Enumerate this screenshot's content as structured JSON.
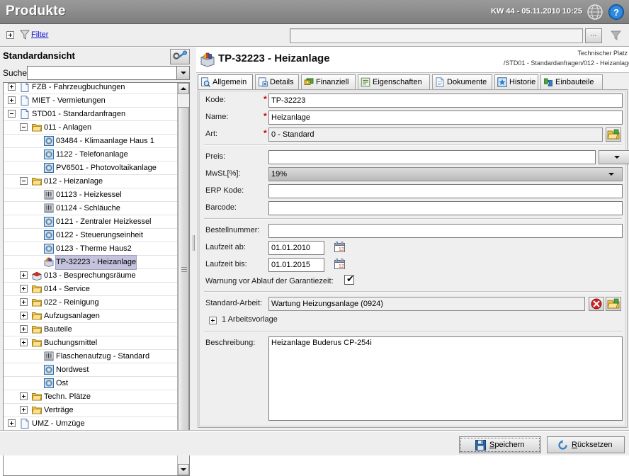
{
  "titlebar": {
    "app_title": "Produkte",
    "clock": "KW 44 - 05.11.2010 10:25",
    "globe_icon": "globe-icon",
    "help_icon": "help-question-icon"
  },
  "filterbar": {
    "expander": "plus-expander-icon",
    "funnel_icon": "funnel-icon",
    "label": "Filter",
    "input_value": "",
    "input_placeholder": "",
    "ellipsis_button": "...",
    "funnel_right_icon": "funnel-icon"
  },
  "sidebar": {
    "title": "Standardansicht",
    "tool_button": "configure-view-icon",
    "search_label": "Suche:",
    "search_value": "",
    "search_placeholder": "",
    "dropdown_icon": "chevron-down-icon",
    "scroll_up_icon": "scroll-up-arrow",
    "scroll_down_icon": "scroll-down-arrow",
    "tree": [
      {
        "label": "FZB - Fahrzeugbuchungen",
        "indent": 0,
        "expander": "plus",
        "icon": "document-blue-icon",
        "selected": false,
        "clipped": true
      },
      {
        "label": "MIET - Vermietungen",
        "indent": 0,
        "expander": "plus",
        "icon": "document-icon",
        "selected": false
      },
      {
        "label": "STD01 - Standardanfragen",
        "indent": 0,
        "expander": "minus",
        "icon": "document-icon",
        "selected": false
      },
      {
        "label": "011 - Anlagen",
        "indent": 1,
        "expander": "minus",
        "icon": "folder-icon",
        "selected": false
      },
      {
        "label": "03484 - Klimaanlage Haus 1",
        "indent": 2,
        "expander": "none",
        "icon": "globe-blue-icon",
        "selected": false
      },
      {
        "label": "1122 - Telefonanlage",
        "indent": 2,
        "expander": "none",
        "icon": "globe-blue-icon",
        "selected": false
      },
      {
        "label": "PV6501 - Photovoltaikanlage",
        "indent": 2,
        "expander": "none",
        "icon": "globe-blue-icon",
        "selected": false
      },
      {
        "label": "012 - Heizanlage",
        "indent": 1,
        "expander": "minus",
        "icon": "folder-icon",
        "selected": false
      },
      {
        "label": "01123 - Heizkessel",
        "indent": 2,
        "expander": "none",
        "icon": "barcode-icon",
        "selected": false
      },
      {
        "label": "01124 - Schläuche",
        "indent": 2,
        "expander": "none",
        "icon": "barcode-icon",
        "selected": false
      },
      {
        "label": "0121 - Zentraler Heizkessel",
        "indent": 2,
        "expander": "none",
        "icon": "globe-blue-icon",
        "selected": false
      },
      {
        "label": "0122 - Steuerungseinheit",
        "indent": 2,
        "expander": "none",
        "icon": "globe-blue-icon",
        "selected": false
      },
      {
        "label": "0123 - Therme Haus2",
        "indent": 2,
        "expander": "none",
        "icon": "globe-blue-icon",
        "selected": false
      },
      {
        "label": "TP-32223 - Heizanlage",
        "indent": 2,
        "expander": "none",
        "icon": "product-box-icon",
        "selected": true
      },
      {
        "label": "013 - Besprechungsräume",
        "indent": 1,
        "expander": "plus",
        "icon": "red-box-icon",
        "selected": false
      },
      {
        "label": "014 - Service",
        "indent": 1,
        "expander": "plus",
        "icon": "folder-icon",
        "selected": false
      },
      {
        "label": "022 - Reinigung",
        "indent": 1,
        "expander": "plus",
        "icon": "folder-icon",
        "selected": false
      },
      {
        "label": "Aufzugsanlagen",
        "indent": 1,
        "expander": "plus",
        "icon": "folder-icon",
        "selected": false
      },
      {
        "label": "Bauteile",
        "indent": 1,
        "expander": "plus",
        "icon": "folder-icon",
        "selected": false
      },
      {
        "label": "Buchungsmittel",
        "indent": 1,
        "expander": "plus",
        "icon": "folder-icon",
        "selected": false
      },
      {
        "label": "Flaschenaufzug - Standard",
        "indent": 2,
        "expander": "none",
        "icon": "barcode-icon",
        "selected": false
      },
      {
        "label": "Nordwest",
        "indent": 2,
        "expander": "none",
        "icon": "globe-blue-icon",
        "selected": false
      },
      {
        "label": "Ost",
        "indent": 2,
        "expander": "none",
        "icon": "globe-blue-icon",
        "selected": false
      },
      {
        "label": "Techn. Plätze",
        "indent": 1,
        "expander": "plus",
        "icon": "folder-icon",
        "selected": false
      },
      {
        "label": "Verträge",
        "indent": 1,
        "expander": "plus",
        "icon": "folder-icon",
        "selected": false
      },
      {
        "label": "UMZ - Umzüge",
        "indent": 0,
        "expander": "plus",
        "icon": "document-icon",
        "selected": false
      }
    ]
  },
  "detail": {
    "icon": "product-box-icon",
    "title": "TP-32223 - Heizanlage",
    "breadcrumb_line1": "Technischer Platz",
    "breadcrumb_line2": "/STD01 - Standardanfragen/012 - Heizanlage",
    "tabs": [
      {
        "label": "Allgemein",
        "icon": "magnifier-doc-icon",
        "active": true
      },
      {
        "label": "Details",
        "icon": "doc-plus-icon",
        "active": false
      },
      {
        "label": "Finanziell",
        "icon": "money-icon",
        "active": false
      },
      {
        "label": "Eigenschaften",
        "icon": "properties-icon",
        "active": false
      },
      {
        "label": "Dokumente",
        "icon": "document-icon",
        "active": false
      },
      {
        "label": "Historie",
        "icon": "history-icon",
        "active": false
      },
      {
        "label": "Einbauteile",
        "icon": "puzzle-icon",
        "active": false
      }
    ],
    "fields": {
      "kode": {
        "label": "Kode:",
        "value": "TP-32223",
        "required": true
      },
      "name": {
        "label": "Name:",
        "value": "Heizanlage",
        "required": true
      },
      "art": {
        "label": "Art:",
        "value": "0 - Standard",
        "required": true,
        "button_icon": "folder-pick-icon"
      },
      "preis": {
        "label": "Preis:",
        "value": "",
        "dropdown_icon": "chevron-down-icon"
      },
      "mwst": {
        "label": "MwSt.[%]:",
        "value": "19%",
        "dropdown_icon": "chevron-down-icon"
      },
      "erp_kode": {
        "label": "ERP Kode:",
        "value": ""
      },
      "barcode": {
        "label": "Barcode:",
        "value": ""
      },
      "bestellnummer": {
        "label": "Bestellnummer:",
        "value": ""
      },
      "laufzeit_ab": {
        "label": "Laufzeit ab:",
        "value": "01.01.2010",
        "calendar_icon": "calendar-icon"
      },
      "laufzeit_bis": {
        "label": "Laufzeit bis:",
        "value": "01.01.2015",
        "calendar_icon": "calendar-icon"
      },
      "warnung": {
        "label": "Warnung vor Ablauf der Garantiezeit:",
        "checked": true
      },
      "standard_arbeit": {
        "label": "Standard-Arbeit:",
        "value": "Wartung Heizungsanlage (0924)",
        "clear_icon": "delete-red-icon",
        "pick_icon": "folder-pick-icon"
      },
      "arbeitsvorlage": {
        "label": "1 Arbeitsvorlage",
        "expander": "plus"
      },
      "beschreibung": {
        "label": "Beschreibung:",
        "value": "Heizanlage Buderus CP-254i"
      }
    }
  },
  "footer": {
    "save_label": "Speichern",
    "save_accesskey": "S",
    "save_icon": "floppy-save-icon",
    "reset_label": "Rücksetzen",
    "reset_accesskey": "R",
    "reset_icon": "refresh-icon"
  },
  "colors": {
    "titlebar": "#8e8e8e",
    "panel_bg": "#efefef",
    "selection": "#c3c3dd",
    "link": "#1111cc",
    "required": "#d00000"
  }
}
